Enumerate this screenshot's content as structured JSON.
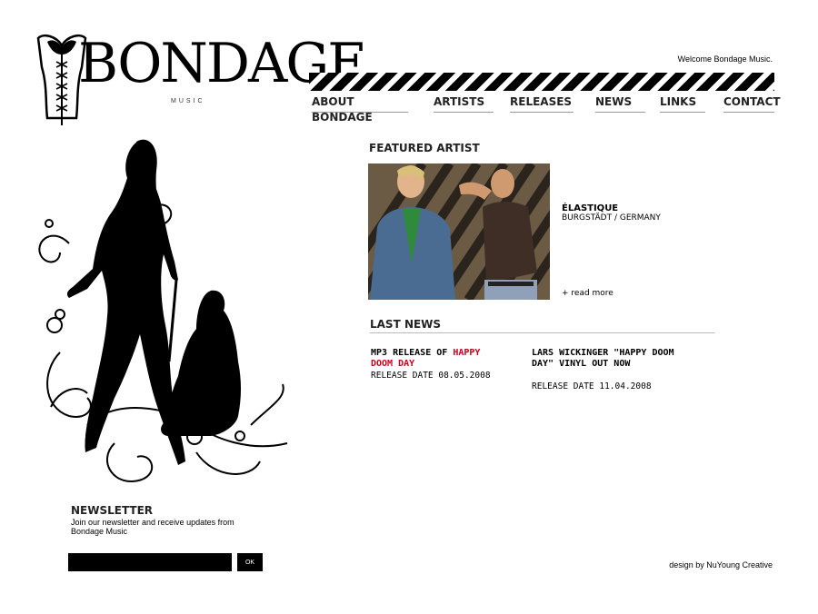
{
  "brand": {
    "logo_text": "BONDAGE",
    "logo_sub": "MUSIC"
  },
  "header": {
    "welcome": "Welcome Bondage Music."
  },
  "nav": {
    "items": [
      {
        "label": "ABOUT BONDAGE"
      },
      {
        "label": "ARTISTS"
      },
      {
        "label": "RELEASES"
      },
      {
        "label": "NEWS"
      },
      {
        "label": "LINKS"
      },
      {
        "label": "CONTACT"
      }
    ]
  },
  "featured": {
    "heading": "FEATURED ARTIST",
    "artist_name": "ÉLASTIQUE",
    "artist_location": "BURGSTÄDT / GERMANY",
    "read_more": "+ read more"
  },
  "news": {
    "heading": "LAST NEWS",
    "items": [
      {
        "title_prefix": "MP3 RELEASE OF ",
        "title_highlight": "HAPPY DOOM DAY",
        "date": "RELEASE DATE 08.05.2008"
      },
      {
        "title_prefix": "LARS WICKINGER \"HAPPY DOOM DAY\"  VINYL OUT NOW",
        "title_highlight": "",
        "date": "RELEASE DATE 11.04.2008"
      }
    ]
  },
  "newsletter": {
    "heading": "NEWSLETTER",
    "text": "Join our newsletter and receive updates from Bondage Music",
    "input_value": "",
    "ok_label": "OK"
  },
  "footer": {
    "credit": "design by NuYoung Creative"
  },
  "colors": {
    "accent_red": "#c8001e",
    "black": "#000000",
    "background": "#ffffff"
  }
}
